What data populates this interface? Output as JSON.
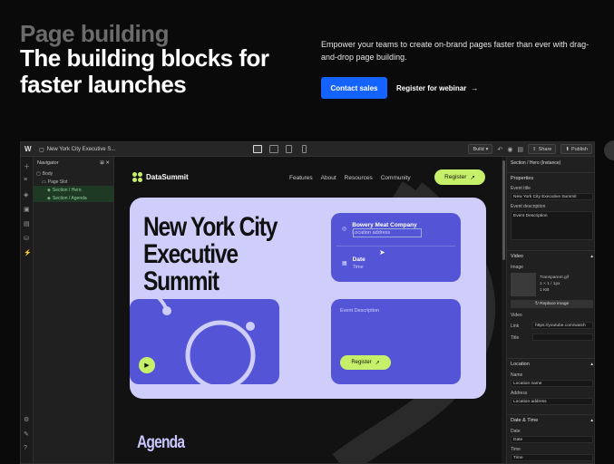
{
  "hero": {
    "eyebrow": "Page building",
    "headline": "The building blocks for faster launches",
    "description": "Empower your teams to create on-brand pages faster than ever with drag-and-drop page building.",
    "cta_primary": "Contact sales",
    "cta_secondary": "Register for webinar",
    "cta_secondary_arrow": "→"
  },
  "editor": {
    "logo": "W",
    "page_name": "New York City Executive S...",
    "topbar": {
      "chip1": "Build",
      "share": "Share",
      "publish": "Publish"
    },
    "navigator": {
      "title": "Navigator",
      "items": [
        {
          "label": "Body",
          "level": 0,
          "selected": false
        },
        {
          "label": "Page Slot",
          "level": 1,
          "selected": false
        },
        {
          "label": "Section / Hero",
          "level": 2,
          "selected": true
        },
        {
          "label": "Section / Agenda",
          "level": 2,
          "selected": true
        }
      ]
    },
    "site": {
      "brand": "DataSummit",
      "links": [
        "Features",
        "About",
        "Resources",
        "Community"
      ],
      "register": "Register",
      "register_arrow": "↗",
      "title": "New York City Executive Summit",
      "venue": "Bowery Meat Company",
      "venue_sub": "Location address",
      "date": "Date",
      "time": "Time",
      "event_desc": "Event Description",
      "register_btn": "Register",
      "agenda": "Agenda"
    },
    "panel": {
      "header": "Section / Hero (Instance)",
      "properties": "Properties",
      "event_title_label": "Event title",
      "event_title_value": "New York City Executive Summit",
      "event_desc_label": "Event description",
      "event_desc_value": "Event Description",
      "video_section": "Video",
      "image_label": "Image",
      "thumb_name": "Transparent.gif",
      "thumb_dims": "1 × 1 / 1px",
      "thumb_size": "1 KB",
      "replace": "Replace image",
      "video_label": "Video",
      "link_label": "Link",
      "link_value": "https://youtube.com/watch",
      "title_label": "Title",
      "location_section": "Location",
      "name_label": "Name",
      "name_value": "Location name",
      "address_label": "Address",
      "address_value": "Location address",
      "datetime_section": "Date & Time",
      "date_label": "Date",
      "date_value": "Date",
      "time_label": "Time",
      "time_value": "Time"
    }
  },
  "colors": {
    "accent_blue": "#1463ff",
    "lime": "#c6f06a",
    "lavender": "#cfcdfa",
    "indigo": "#5455d6"
  }
}
